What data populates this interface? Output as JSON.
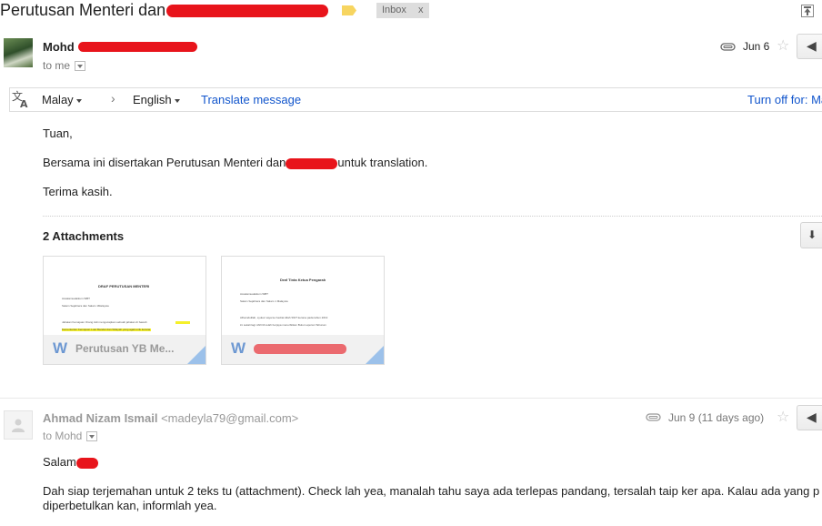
{
  "header": {
    "subject": "Perutusan Menteri dan",
    "label_chip": "Inbox",
    "label_chip_close": "x",
    "label_color": "#f7d560"
  },
  "message1": {
    "sender": "Mohd",
    "to_me": "to me",
    "date": "Jun 6",
    "translate": {
      "source_lang": "Malay",
      "arrow": "›",
      "target_lang": "English",
      "translate_link": "Translate message",
      "turn_off_link": "Turn off for: Ma"
    },
    "body": {
      "greeting": "Tuan,",
      "line_pre": "Bersama ini disertakan Perutusan Menteri dan",
      "line_post": "untuk translation.",
      "closing": "Terima kasih."
    },
    "attachments": {
      "title": "2 Attachments",
      "items": [
        {
          "name": "Perutusan YB Me...",
          "preview_title": "DRAF PERUTUSAN MENTERI",
          "preview_lines": [
            "Assalamualaikum WBT",
            "Salam Sejahtera dan Salam 1Malaysia",
            "Jabatan Kemajuan Orang Asli mengucapkan sebuah jabatan di bawah",
            "Kementerian Kemajuan Luar Bandar dan Wilayah yang agak unik kerana"
          ]
        },
        {
          "name": "",
          "preview_title": "Draf Tinta Ketua Pengarah",
          "preview_lines": [
            "Assalamualaikum WBT",
            "Salam Sejahtera dan Salam 1 Malaysia",
            "Alhamdulilah, syukur saya ke hadrat Allah SWT kerana pada tahun 2013",
            "ini sekali lagi JAKOA telah berjaya menerbitkan Buku Laporan Tahunan"
          ]
        }
      ]
    }
  },
  "message2": {
    "sender_name": "Ahmad Nizam Ismail",
    "sender_email": "<madeyla79@gmail.com>",
    "to": "to Mohd",
    "date": "Jun 9 (11 days ago)",
    "greeting": "Salam",
    "body_line1": "Dah siap terjemahan untuk 2 teks tu (attachment). Check lah yea, manalah tahu saya ada terlepas pandang, tersalah taip ker apa. Kalau ada yang p",
    "body_line2": "diperbetulkan kan, informlah yea."
  },
  "colors": {
    "link": "#1155cc",
    "redaction": "#e8141b",
    "attachment_icon": "#6d98d2"
  }
}
